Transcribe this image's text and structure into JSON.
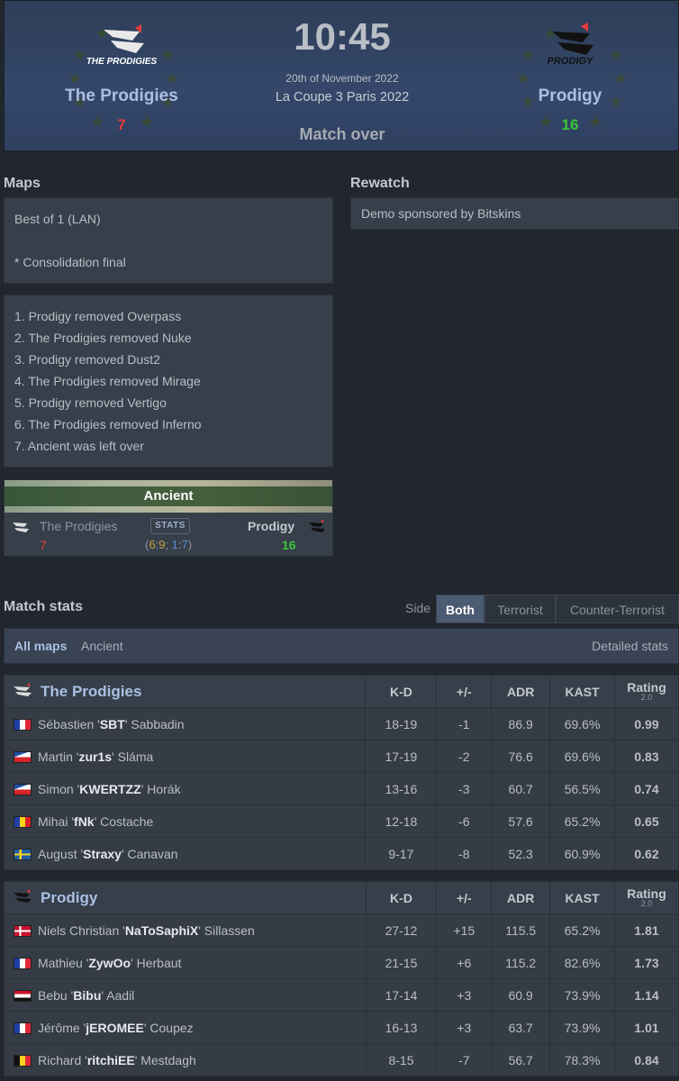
{
  "header": {
    "time": "10:45",
    "date": "20th of November 2022",
    "event": "La Coupe 3 Paris 2022",
    "status": "Match over",
    "team1": {
      "name": "The Prodigies",
      "score": "7",
      "logo_text": "THE PRODIGIES"
    },
    "team2": {
      "name": "Prodigy",
      "score": "16",
      "logo_text": "PRODIGY"
    }
  },
  "maps": {
    "title": "Maps",
    "format": "Best of 1 (LAN)",
    "note": "* Consolidation final",
    "veto": [
      "1. Prodigy removed Overpass",
      "2. The Prodigies removed Nuke",
      "3. Prodigy removed Dust2",
      "4. The Prodigies removed Mirage",
      "5. Prodigy removed Vertigo",
      "6. The Prodigies removed Inferno",
      "7. Ancient was left over"
    ],
    "result": {
      "map": "Ancient",
      "team1": "The Prodigies",
      "team1_score": "7",
      "team2": "Prodigy",
      "team2_score": "16",
      "stats_label": "STATS",
      "half_open": "(",
      "half1_a": "6",
      "half1_sep": ":",
      "half1_b": "9",
      "half_join": "; ",
      "half2_a": "1",
      "half2_sep": ":",
      "half2_b": "7",
      "half_close": ")"
    }
  },
  "rewatch": {
    "title": "Rewatch",
    "demo": "Demo sponsored by Bitskins"
  },
  "match_stats": {
    "title": "Match stats",
    "side_label": "Side",
    "side_options": [
      "Both",
      "Terrorist",
      "Counter-Terrorist"
    ],
    "maps_tabs": [
      "All maps",
      "Ancient"
    ],
    "detailed": "Detailed stats",
    "columns": {
      "kd": "K-D",
      "pm": "+/-",
      "adr": "ADR",
      "kast": "KAST",
      "rating": "Rating",
      "rating_sub": "2.0"
    },
    "team1": {
      "name": "The Prodigies",
      "players": [
        {
          "flag": "fr",
          "first": "Sébastien '",
          "nick": "SBT",
          "last": "' Sabbadin",
          "kd": "18-19",
          "pm": "-1",
          "adr": "86.9",
          "kast": "69.6%",
          "rating": "0.99"
        },
        {
          "flag": "cz",
          "first": "Martin '",
          "nick": "zur1s",
          "last": "' Sláma",
          "kd": "17-19",
          "pm": "-2",
          "adr": "76.6",
          "kast": "69.6%",
          "rating": "0.83"
        },
        {
          "flag": "cz",
          "first": "Simon '",
          "nick": "KWERTZZ",
          "last": "' Horák",
          "kd": "13-16",
          "pm": "-3",
          "adr": "60.7",
          "kast": "56.5%",
          "rating": "0.74"
        },
        {
          "flag": "ro",
          "first": "Mihai '",
          "nick": "fNk",
          "last": "' Costache",
          "kd": "12-18",
          "pm": "-6",
          "adr": "57.6",
          "kast": "65.2%",
          "rating": "0.65"
        },
        {
          "flag": "se",
          "first": "August '",
          "nick": "Straxy",
          "last": "' Canavan",
          "kd": "9-17",
          "pm": "-8",
          "adr": "52.3",
          "kast": "60.9%",
          "rating": "0.62"
        }
      ]
    },
    "team2": {
      "name": "Prodigy",
      "players": [
        {
          "flag": "dk",
          "first": "Niels Christian '",
          "nick": "NaToSaphiX",
          "last": "' Sillassen",
          "kd": "27-12",
          "pm": "+15",
          "adr": "115.5",
          "kast": "65.2%",
          "rating": "1.81"
        },
        {
          "flag": "fr",
          "first": "Mathieu '",
          "nick": "ZywOo",
          "last": "' Herbaut",
          "kd": "21-15",
          "pm": "+6",
          "adr": "115.2",
          "kast": "82.6%",
          "rating": "1.73"
        },
        {
          "flag": "eg",
          "first": "Bebu '",
          "nick": "Bibu",
          "last": "' Aadil",
          "kd": "17-14",
          "pm": "+3",
          "adr": "60.9",
          "kast": "73.9%",
          "rating": "1.14"
        },
        {
          "flag": "fr",
          "first": "Jérôme '",
          "nick": "jEROMEE",
          "last": "' Coupez",
          "kd": "16-13",
          "pm": "+3",
          "adr": "63.7",
          "kast": "73.9%",
          "rating": "1.01"
        },
        {
          "flag": "be",
          "first": "Richard '",
          "nick": "ritchiEE",
          "last": "' Mestdagh",
          "kd": "8-15",
          "pm": "-7",
          "adr": "56.7",
          "kast": "78.3%",
          "rating": "0.84"
        }
      ]
    }
  },
  "colors": {
    "win": "#3bc43b",
    "lose": "#e43b3b",
    "accent": "#a9c0e2",
    "active_tab": "#4b5b72"
  }
}
